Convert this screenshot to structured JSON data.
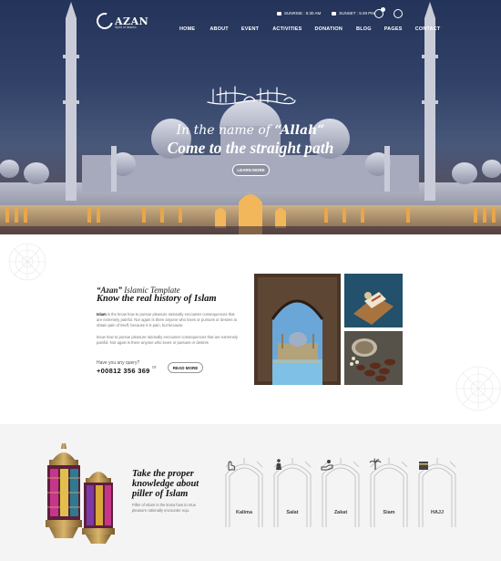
{
  "header": {
    "logo_text": "AZAN",
    "logo_sub": "Spirit of Islamic",
    "sunrise": "SUNRISE : 5:30 AM",
    "sunset": "SUNSET : 5:49 PM",
    "nav": [
      "HOME",
      "ABOUT",
      "EVENT",
      "ACTIVITIES",
      "DONATION",
      "BLOG",
      "PAGES",
      "CONTACT"
    ]
  },
  "hero": {
    "subtitle_pre": "In the name of",
    "subtitle_highlight": "“Allah”",
    "title": "Come to the straight path",
    "button": "LEARN MORE"
  },
  "about": {
    "kicker_brand": "“Azan”",
    "kicker_rest": "Islamic Template",
    "title": "Know the real history of Islam",
    "p1_bold": "Islam",
    "p1": "is the know how to pursue pleasure rationally encounter consequences that are extremely painful. Nor again is there anyone who loves or pursues or desires to obtain pain of itself, because it is pain, but because",
    "p2": "know how to pursue pleasure rationally encounter consequences that are extremely painful. Nor again is there anyone who loves or pursues or desires",
    "query_label": "Have you any query?",
    "phone": "+00812 356 369",
    "or": "or",
    "button": "READ MORE"
  },
  "pillars": {
    "title": "Take the proper knowledge about piller of Islam",
    "text": "Piller of Islam is the know how to rsue pleasure rationally encounter equ.",
    "items": [
      {
        "label": "Kalima",
        "icon": "hand-icon"
      },
      {
        "label": "Salat",
        "icon": "prayer-icon"
      },
      {
        "label": "Zakat",
        "icon": "charity-hand-icon"
      },
      {
        "label": "Siam",
        "icon": "palm-tree-icon"
      },
      {
        "label": "HAJJ",
        "icon": "kaaba-icon"
      }
    ]
  }
}
